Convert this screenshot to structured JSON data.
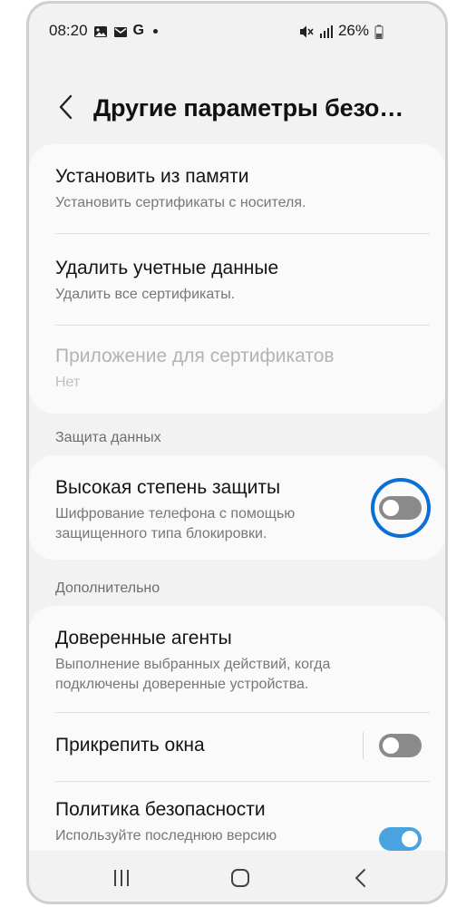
{
  "statusbar": {
    "time": "08:20",
    "letter": "G",
    "battery": "26%",
    "icons": [
      "image-icon",
      "mail-icon",
      "google-icon",
      "dot-icon",
      "mute-icon",
      "signal-icon",
      "battery-icon"
    ]
  },
  "header": {
    "title": "Другие параметры безо…",
    "back_icon": "back-chevron-icon"
  },
  "certificates": {
    "items": [
      {
        "title": "Установить из памяти",
        "subtitle": "Установить сертификаты с носителя."
      },
      {
        "title": "Удалить учетные данные",
        "subtitle": "Удалить все сертификаты."
      },
      {
        "title": "Приложение для сертификатов",
        "subtitle": "Нет",
        "disabled": true
      }
    ]
  },
  "data_protection": {
    "label": "Защита данных",
    "item": {
      "title": "Высокая степень защиты",
      "subtitle_line1": "Шифрование телефона с помощью",
      "subtitle_line2": "защищенного типа блокировки.",
      "enabled": false
    },
    "highlight_color": "#0a6fd6"
  },
  "advanced": {
    "label": "Дополнительно",
    "trusted_agents": {
      "title": "Доверенные агенты",
      "subtitle_line1": "Выполнение выбранных действий, когда",
      "subtitle_line2": "подключены доверенные устройства."
    },
    "pin_windows": {
      "title": "Прикрепить окна",
      "enabled": false
    },
    "security_policy": {
      "title": "Политика безопасности",
      "subtitle": "Используйте последнюю версию",
      "enabled": true
    }
  },
  "navbar": {
    "icons": [
      "recents-icon",
      "home-icon",
      "back-icon"
    ]
  },
  "colors": {
    "background": "#f2f2f2",
    "card": "#fafafa",
    "toggle_off": "#8a8a8a",
    "toggle_on": "#4aa3df"
  }
}
